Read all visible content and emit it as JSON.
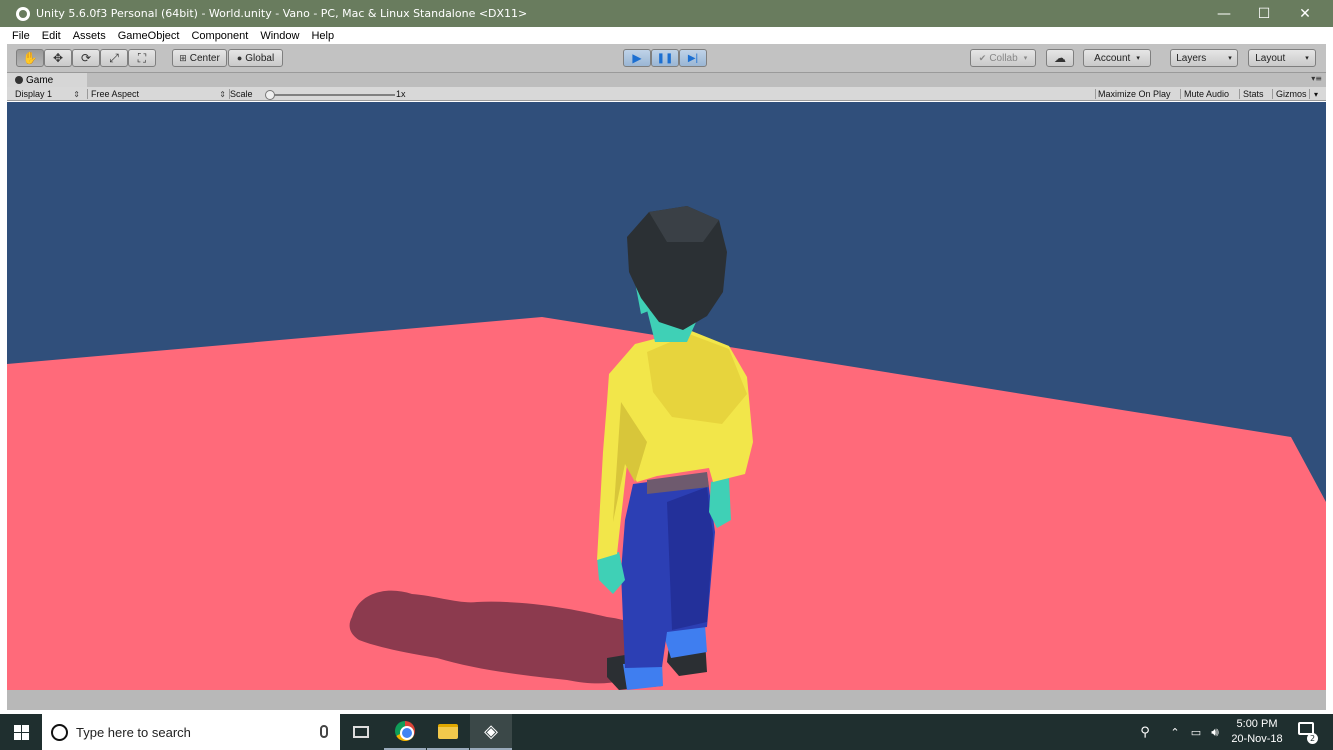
{
  "window": {
    "title": "Unity 5.6.0f3 Personal (64bit) - World.unity - Vano - PC, Mac & Linux Standalone <DX11>",
    "controls": {
      "minimize": "—",
      "maximize": "☐",
      "close": "✕"
    }
  },
  "menu": [
    "File",
    "Edit",
    "Assets",
    "GameObject",
    "Component",
    "Window",
    "Help"
  ],
  "toolbar": {
    "tools": [
      "hand-tool",
      "move-tool",
      "rotate-tool",
      "scale-tool",
      "rect-tool"
    ],
    "pivot_mode": "Center",
    "pivot_rotation": "Global",
    "playback": {
      "play": "▶",
      "pause": "❚❚",
      "step": "▶|"
    },
    "collab": "Collab",
    "account": "Account",
    "layers": "Layers",
    "layout": "Layout",
    "dropdown_glyph": "▾"
  },
  "game_view": {
    "tab_label": "Game",
    "tab_menu": "▾≡",
    "display": "Display 1",
    "aspect": "Free Aspect",
    "scale_label": "Scale",
    "scale_value": "1x",
    "maximize_on_play": "Maximize On Play",
    "mute_audio": "Mute Audio",
    "stats": "Stats",
    "gizmos": "Gizmos",
    "gizmos_dropdown": "▾"
  },
  "scene_colors": {
    "sky": "#304f7b",
    "ground": "#ff6a7a",
    "shadow": "#8c3a4e",
    "hair": "#2b3034",
    "skin": "#3fd0b6",
    "shirt": "#f2e64a",
    "pants": "#2c3fb4",
    "shoes": "#2b2f33"
  },
  "taskbar": {
    "search_placeholder": "Type here to search",
    "time": "5:00 PM",
    "date": "20-Nov-18",
    "notification_count": "2",
    "pinned": [
      "task-view",
      "chrome",
      "file-explorer",
      "unity"
    ]
  }
}
